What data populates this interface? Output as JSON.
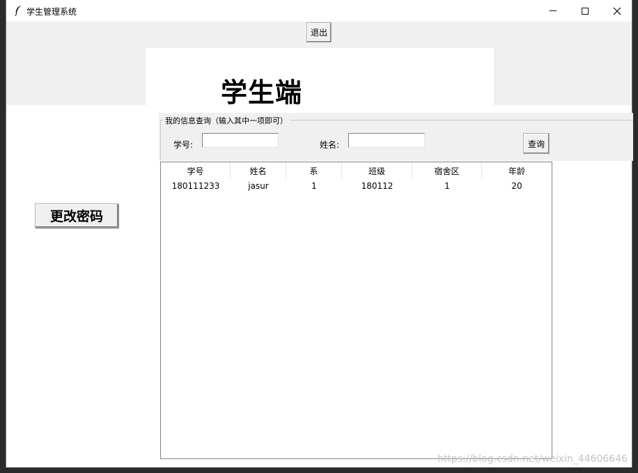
{
  "window": {
    "title": "学生管理系统"
  },
  "toolbar": {
    "logout_label": "退出"
  },
  "banner": {
    "text": "学生端"
  },
  "sidebar": {
    "change_password_label": "更改密码"
  },
  "query": {
    "frame_label": "我的信息查询（输入其中一项即可）",
    "student_id_label": "学号:",
    "student_id_value": "",
    "name_label": "姓名:",
    "name_value": "",
    "query_button_label": "查询"
  },
  "table": {
    "columns": [
      "学号",
      "姓名",
      "系",
      "班级",
      "宿舍区",
      "年龄"
    ],
    "rows": [
      [
        "180111233",
        "jasur",
        "1",
        "180112",
        "1",
        "20"
      ]
    ]
  },
  "watermark": "https://blog.csdn.net/weixin_44606646"
}
